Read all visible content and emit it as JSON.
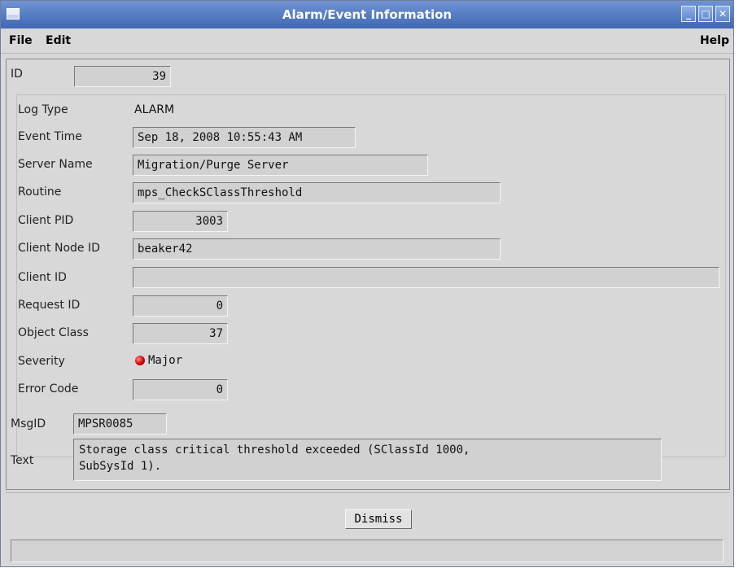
{
  "window": {
    "title": "Alarm/Event Information"
  },
  "menu": {
    "file": "File",
    "edit": "Edit",
    "help": "Help"
  },
  "titlebar_buttons": [
    "minimize-icon",
    "maximize-icon",
    "close-icon"
  ],
  "fields": {
    "id": {
      "label": "ID",
      "value": "39"
    },
    "log_type": {
      "label": "Log Type",
      "value": "ALARM"
    },
    "event_time": {
      "label": "Event Time",
      "value": "Sep 18, 2008 10:55:43 AM"
    },
    "server_name": {
      "label": "Server Name",
      "value": "Migration/Purge Server"
    },
    "routine": {
      "label": "Routine",
      "value": "mps_CheckSClassThreshold"
    },
    "client_pid": {
      "label": "Client PID",
      "value": "3003"
    },
    "client_node_id": {
      "label": "Client Node ID",
      "value": "beaker42"
    },
    "client_id": {
      "label": "Client ID",
      "value": ""
    },
    "request_id": {
      "label": "Request ID",
      "value": "0"
    },
    "object_class": {
      "label": "Object Class",
      "value": "37"
    },
    "severity": {
      "label": "Severity",
      "value": "Major",
      "color": "#d00000"
    },
    "error_code": {
      "label": "Error Code",
      "value": "0"
    },
    "msgid": {
      "label": "MsgID",
      "value": "MPSR0085"
    },
    "text": {
      "label": "Text",
      "line1": "Storage class critical threshold exceeded (SClassId 1000,",
      "line2": "SubSysId 1)."
    }
  },
  "buttons": {
    "dismiss": "Dismiss"
  },
  "status": {
    "text": ""
  }
}
